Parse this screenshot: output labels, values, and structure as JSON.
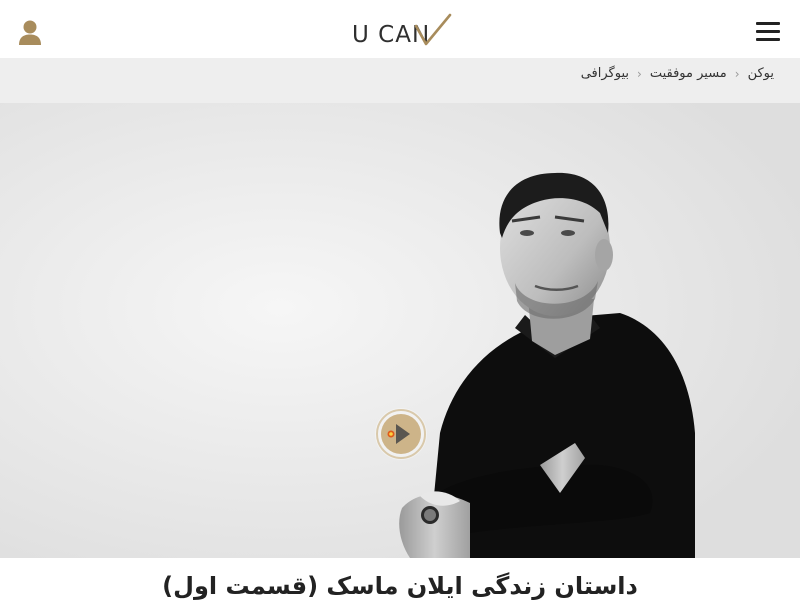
{
  "header": {
    "logo_text": "U CAN",
    "user_icon": "user-icon",
    "menu_icon": "hamburger-menu-icon"
  },
  "breadcrumb": {
    "items": [
      {
        "label": "یوکن"
      },
      {
        "label": "مسیر موفقیت"
      },
      {
        "label": "بیوگرافی"
      }
    ],
    "separator_icon": "chevron-left-icon"
  },
  "hero": {
    "play_icon": "play-icon"
  },
  "article": {
    "title": "داستان زندگی ایلان ماسک (قسمت اول)"
  },
  "colors": {
    "brand_gold": "#a88c5c",
    "header_bg": "#ffffff",
    "breadcrumb_bg": "#eeeeee",
    "text_dark": "#222222"
  }
}
